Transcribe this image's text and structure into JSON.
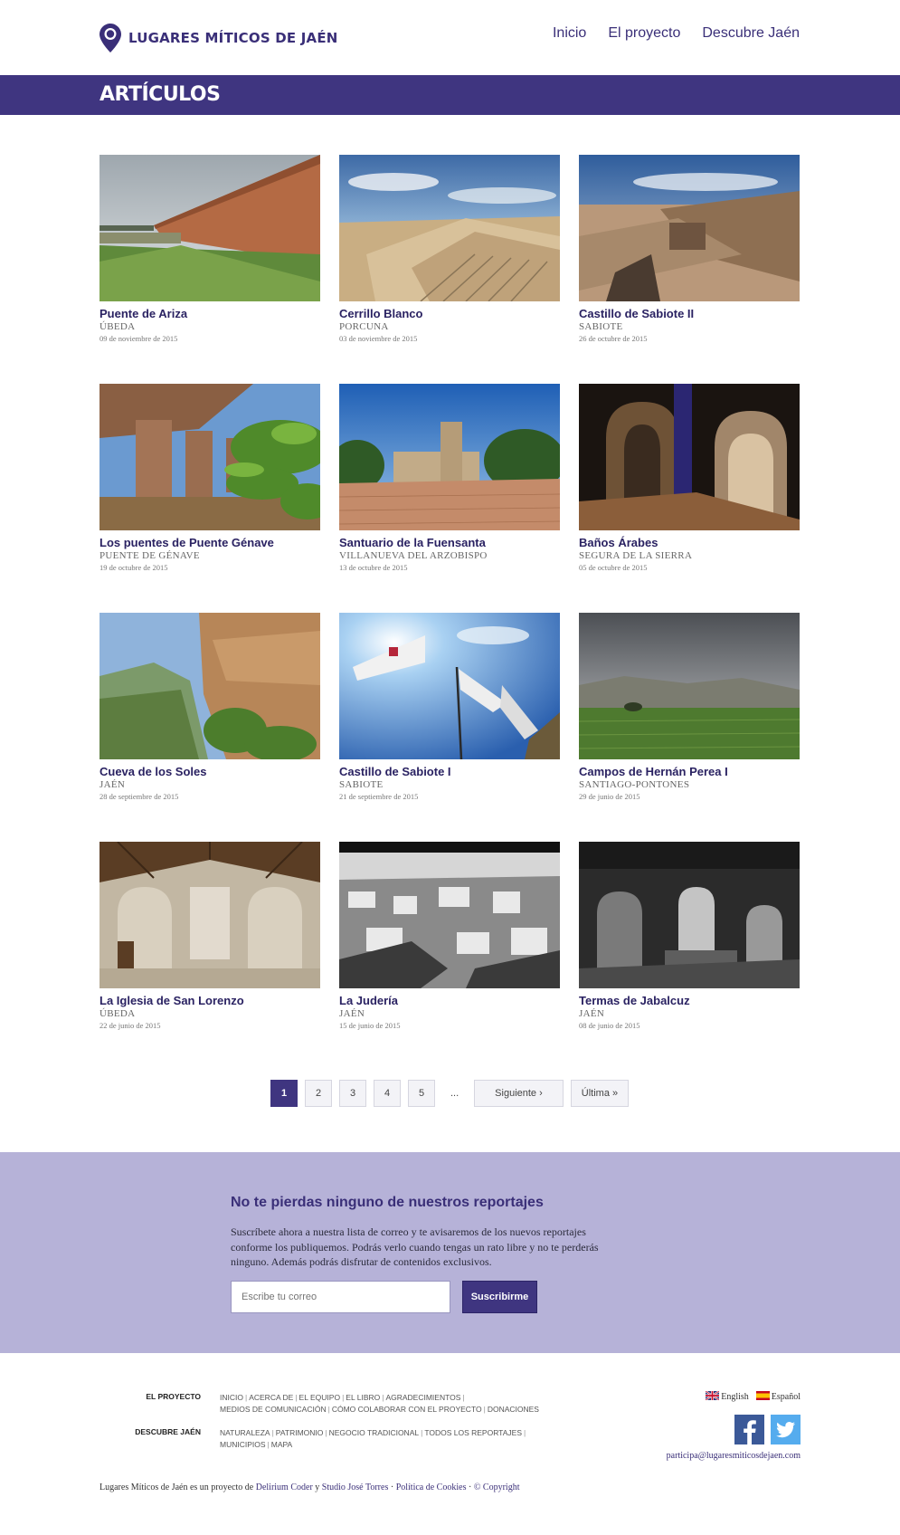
{
  "header": {
    "logo_text": "LUGARES MÍTICOS DE JAÉN",
    "nav": [
      "Inicio",
      "El proyecto",
      "Descubre Jaén"
    ]
  },
  "page_title": "ARTÍCULOS",
  "articles": [
    {
      "title": "Puente de Ariza",
      "place": "ÚBEDA",
      "date": "09 de noviembre de 2015"
    },
    {
      "title": "Cerrillo Blanco",
      "place": "PORCUNA",
      "date": "03 de noviembre de 2015"
    },
    {
      "title": "Castillo de Sabiote II",
      "place": "SABIOTE",
      "date": "26 de octubre de 2015"
    },
    {
      "title": "Los puentes de Puente Génave",
      "place": "PUENTE DE GÉNAVE",
      "date": "19 de octubre de 2015"
    },
    {
      "title": "Santuario de la Fuensanta",
      "place": "VILLANUEVA DEL ARZOBISPO",
      "date": "13 de octubre de 2015"
    },
    {
      "title": "Baños Árabes",
      "place": "SEGURA DE LA SIERRA",
      "date": "05 de octubre de 2015"
    },
    {
      "title": "Cueva de los Soles",
      "place": "JAÉN",
      "date": "28 de septiembre de 2015"
    },
    {
      "title": "Castillo de Sabiote I",
      "place": "SABIOTE",
      "date": "21 de septiembre de 2015"
    },
    {
      "title": "Campos de Hernán Perea I",
      "place": "SANTIAGO-PONTONES",
      "date": "29 de junio de 2015"
    },
    {
      "title": "La Iglesia de San Lorenzo",
      "place": "ÚBEDA",
      "date": "22 de junio de 2015"
    },
    {
      "title": "La Judería",
      "place": "JAÉN",
      "date": "15 de junio de 2015"
    },
    {
      "title": "Termas de Jabalcuz",
      "place": "JAÉN",
      "date": "08 de junio de 2015"
    }
  ],
  "pagination": {
    "pages": [
      "1",
      "2",
      "3",
      "4",
      "5"
    ],
    "current": "1",
    "ellipsis": "...",
    "next": "Siguiente ›",
    "last": "Última »"
  },
  "newsletter": {
    "title": "No te pierdas ninguno de nuestros reportajes",
    "text": "Suscríbete ahora a nuestra lista de correo y te avisaremos de los nuevos reportajes conforme los publiquemos. Podrás verlo cuando tengas un rato libre y no te perderás ninguno. Además podrás disfrutar de contenidos exclusivos.",
    "placeholder": "Escribe tu correo",
    "button": "Suscribirme"
  },
  "footer": {
    "proyecto_label": "EL PROYECTO",
    "proyecto_links": [
      "INICIO",
      "ACERCA DE",
      "EL EQUIPO",
      "EL LIBRO",
      "AGRADECIMIENTOS",
      "MEDIOS DE COMUNICACIÓN",
      "CÓMO COLABORAR CON EL PROYECTO",
      "DONACIONES"
    ],
    "descubre_label": "DESCUBRE JAÉN",
    "descubre_links": [
      "NATURALEZA",
      "PATRIMONIO",
      "NEGOCIO TRADICIONAL",
      "TODOS LOS REPORTAJES",
      "MUNICIPIOS",
      "MAPA"
    ],
    "lang_english": "English",
    "lang_spanish": "Español",
    "email": "participa@lugaresmiticosdejaen.com",
    "credits_prefix": "Lugares Míticos de Jaén es un proyecto de",
    "credits_delirium": "Delirium Coder",
    "credits_and": "y",
    "credits_studio": "Studio José Torres",
    "credits_cookies": "Política de Cookies",
    "credits_copyright": "© Copyright"
  },
  "colors": {
    "brand": "#3f3580",
    "newsletter_bg": "#b6b2d8"
  }
}
